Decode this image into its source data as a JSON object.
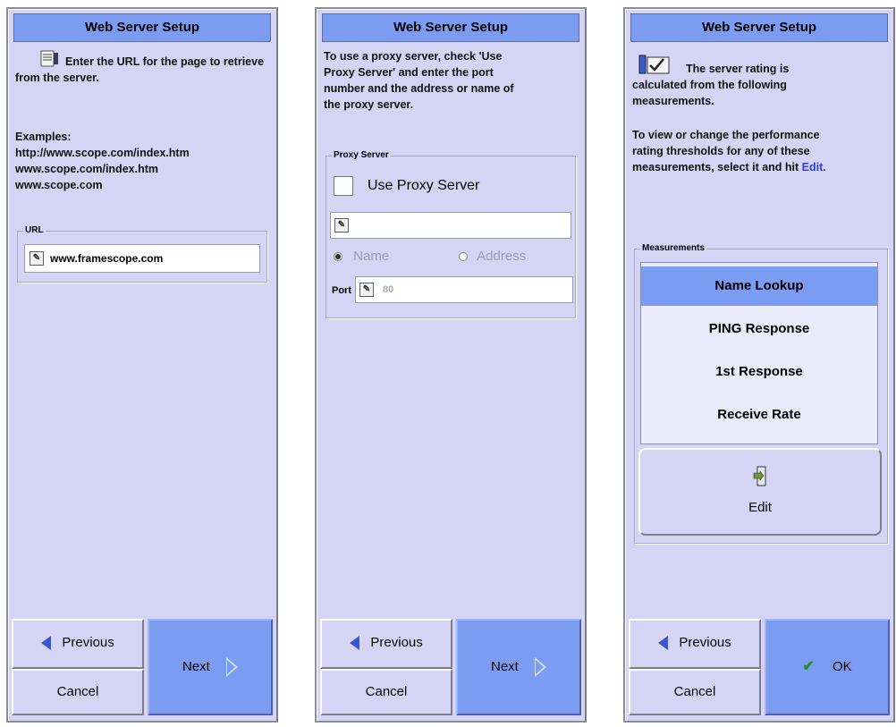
{
  "panels": [
    {
      "title": "Web Server Setup",
      "instruction": "Enter the URL for the page to retrieve from the server.",
      "examples_label": "Examples:",
      "examples": [
        "http://www.scope.com/index.htm",
        "www.scope.com/index.htm",
        "www.scope.com"
      ],
      "group_label": "URL",
      "url_value": "www.framescope.com",
      "previous_label": "Previous",
      "cancel_label": "Cancel",
      "next_label": "Next"
    },
    {
      "title": "Web Server Setup",
      "instruction_lines": [
        "To use a proxy server, check 'Use",
        "Proxy Server' and enter the port",
        "number and the address or name of",
        "the proxy server."
      ],
      "group_label": "Proxy Server",
      "use_proxy_label": "Use Proxy Server",
      "proxy_value": "",
      "name_label": "Name",
      "address_label": "Address",
      "port_label": "Port",
      "port_value": "80",
      "previous_label": "Previous",
      "cancel_label": "Cancel",
      "next_label": "Next"
    },
    {
      "title": "Web Server Setup",
      "intro_lines": [
        "The server rating is",
        "calculated from the following",
        "measurements."
      ],
      "info_lines_1": [
        "To view or change the performance",
        "rating thresholds for any of these"
      ],
      "info_line_last": "measurements, select it and hit ",
      "edit_link": "Edit.",
      "group_label": "Measurements",
      "measurements": [
        "Name Lookup",
        "PING Response",
        "1st Response",
        "Receive Rate"
      ],
      "edit_button": "Edit",
      "previous_label": "Previous",
      "cancel_label": "Cancel",
      "ok_label": "OK"
    }
  ],
  "colors": {
    "panel_bg": "#d5d4f4",
    "accent_blue": "#7c9cf2",
    "link": "#2f3fdf"
  }
}
